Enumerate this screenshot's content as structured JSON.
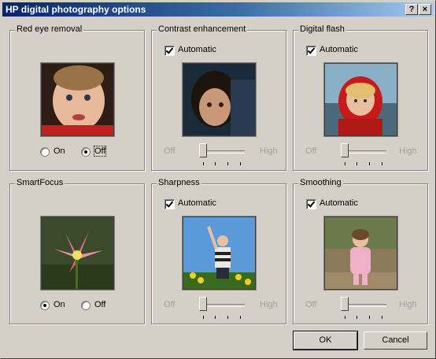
{
  "window": {
    "title": "HP digital photography options",
    "help": "?",
    "close": "×"
  },
  "red_eye": {
    "label": "Red eye removal",
    "on": "On",
    "off": "Off",
    "selected": "Off"
  },
  "contrast": {
    "label": "Contrast enhancement",
    "automatic": "Automatic",
    "automatic_checked": true,
    "slider_low": "Off",
    "slider_high": "High"
  },
  "digital_flash": {
    "label": "Digital flash",
    "automatic": "Automatic",
    "automatic_checked": true,
    "slider_low": "Off",
    "slider_high": "High"
  },
  "smartfocus": {
    "label": "SmartFocus",
    "on": "On",
    "off": "Off",
    "selected": "On"
  },
  "sharpness": {
    "label": "Sharpness",
    "automatic": "Automatic",
    "automatic_checked": true,
    "slider_low": "Off",
    "slider_high": "High"
  },
  "smoothing": {
    "label": "Smoothing",
    "automatic": "Automatic",
    "automatic_checked": true,
    "slider_low": "Off",
    "slider_high": "High"
  },
  "buttons": {
    "ok": "OK",
    "cancel": "Cancel"
  }
}
